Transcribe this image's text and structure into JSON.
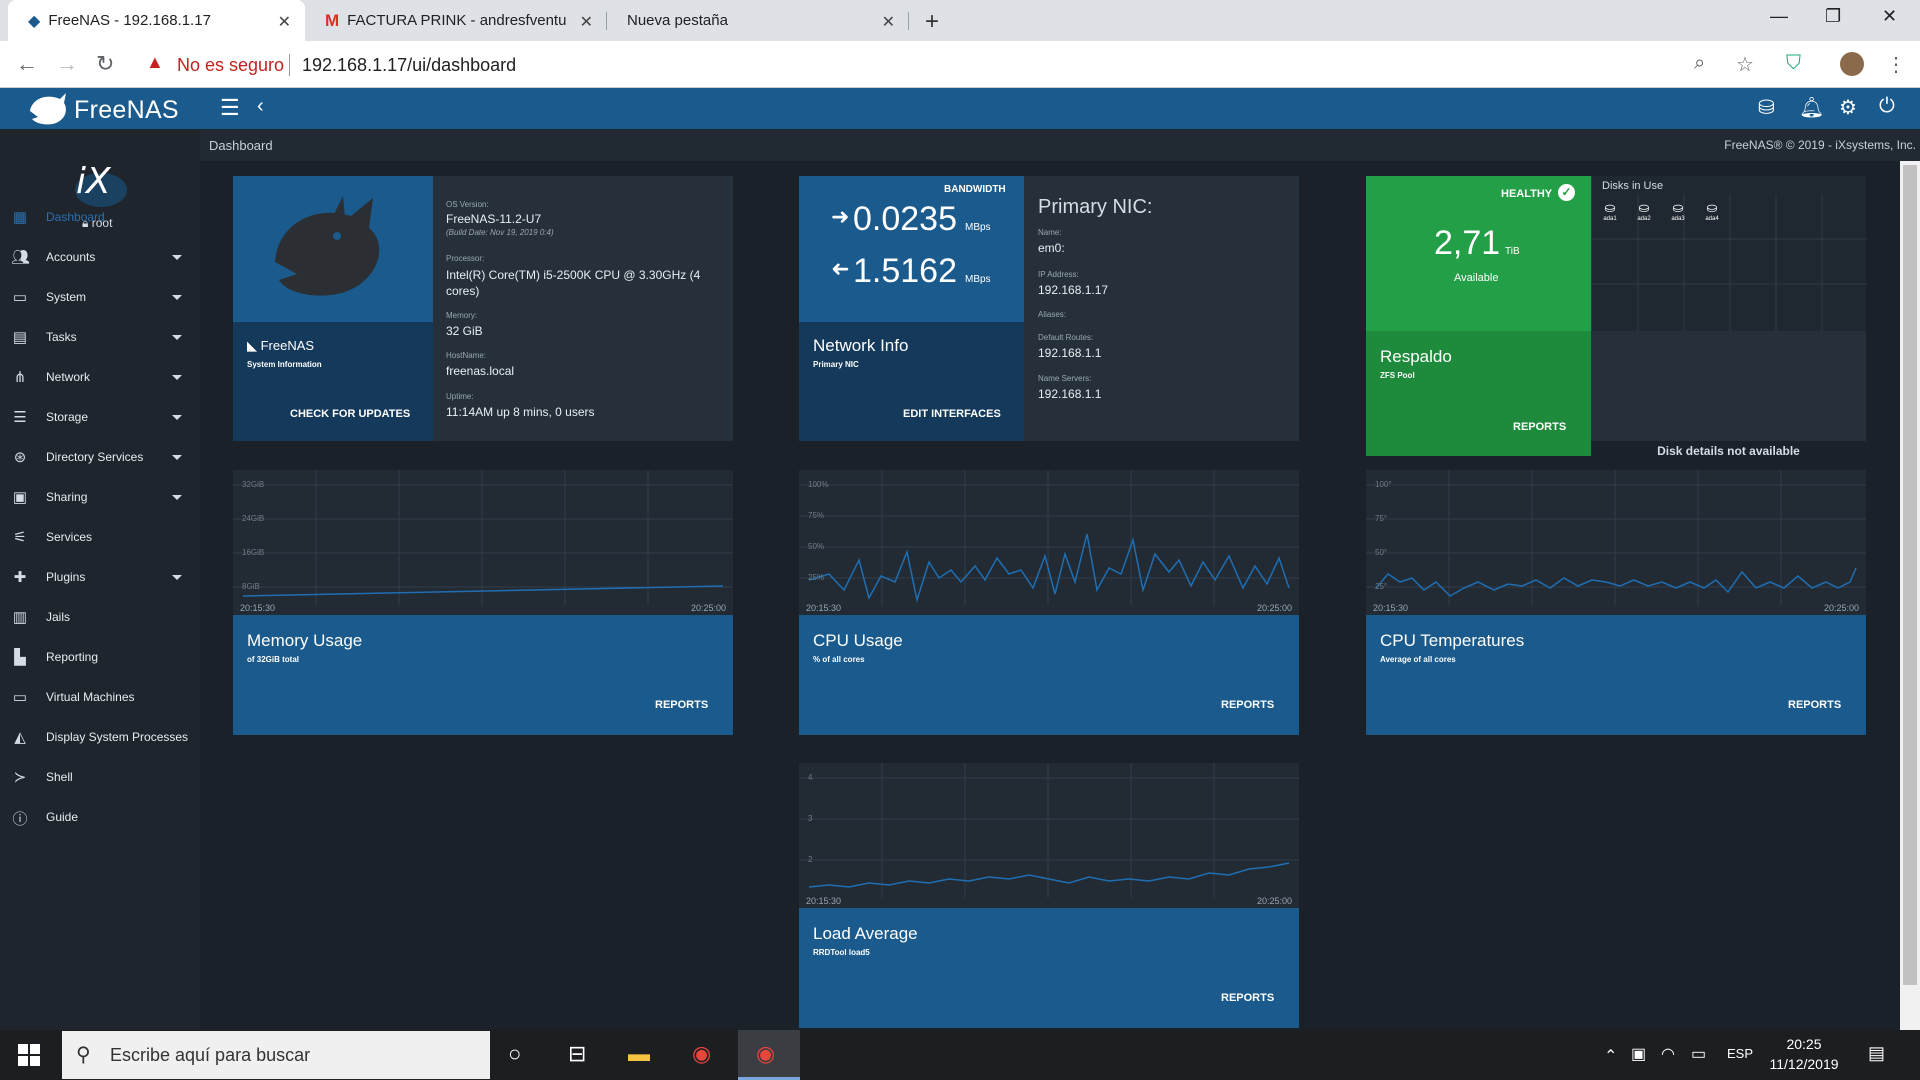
{
  "browser": {
    "tabs": [
      {
        "title": "FreeNAS - 192.168.1.17",
        "active": true
      },
      {
        "title": "FACTURA PRINK - andresfventura",
        "active": false
      },
      {
        "title": "Nueva pestaña",
        "active": false
      }
    ],
    "not_secure": "No es seguro",
    "url": "192.168.1.17/ui/dashboard"
  },
  "header": {
    "logo": "FreeNAS",
    "breadcrumb": "Dashboard",
    "copyright": "FreeNAS® © 2019 - iXsystems, Inc."
  },
  "sidebar": {
    "user": "root",
    "items": [
      {
        "label": "Dashboard",
        "icon": "dashboard-icon",
        "arrow": false
      },
      {
        "label": "Accounts",
        "icon": "accounts-icon",
        "arrow": true
      },
      {
        "label": "System",
        "icon": "system-icon",
        "arrow": true
      },
      {
        "label": "Tasks",
        "icon": "tasks-icon",
        "arrow": true
      },
      {
        "label": "Network",
        "icon": "network-icon",
        "arrow": true
      },
      {
        "label": "Storage",
        "icon": "storage-icon",
        "arrow": true
      },
      {
        "label": "Directory Services",
        "icon": "directory-icon",
        "arrow": true
      },
      {
        "label": "Sharing",
        "icon": "sharing-icon",
        "arrow": true
      },
      {
        "label": "Services",
        "icon": "services-icon",
        "arrow": false
      },
      {
        "label": "Plugins",
        "icon": "plugins-icon",
        "arrow": true
      },
      {
        "label": "Jails",
        "icon": "jails-icon",
        "arrow": false
      },
      {
        "label": "Reporting",
        "icon": "reporting-icon",
        "arrow": false
      },
      {
        "label": "Virtual Machines",
        "icon": "vm-icon",
        "arrow": false
      },
      {
        "label": "Display System Processes",
        "icon": "processes-icon",
        "arrow": false
      },
      {
        "label": "Shell",
        "icon": "shell-icon",
        "arrow": false
      },
      {
        "label": "Guide",
        "icon": "guide-icon",
        "arrow": false
      }
    ]
  },
  "sysinfo": {
    "brand": "FreeNAS",
    "subtitle": "System Information",
    "action": "CHECK FOR UPDATES",
    "os_label": "OS Version:",
    "os": "FreeNAS-11.2-U7",
    "build": "(Build Date: Nov 19, 2019 0:4)",
    "proc_label": "Processor:",
    "processor": "Intel(R) Core(TM) i5-2500K CPU @ 3.30GHz (4 cores)",
    "mem_label": "Memory:",
    "memory": "32 GiB",
    "host_label": "HostName:",
    "hostname": "freenas.local",
    "uptime_label": "Uptime:",
    "uptime": "11:14AM up 8 mins, 0 users"
  },
  "network": {
    "bandwidth_label": "BANDWIDTH",
    "out_value": "0.0235",
    "in_value": "1.5162",
    "unit": "MBps",
    "title": "Network Info",
    "subtitle": "Primary NIC",
    "action": "EDIT INTERFACES",
    "nic_title": "Primary NIC:",
    "name_label": "Name:",
    "name": "em0:",
    "ip_label": "IP Address:",
    "ip": "192.168.1.17",
    "aliases_label": "Aliases:",
    "routes_label": "Default Routes:",
    "routes": "192.168.1.1",
    "dns_label": "Name Servers:",
    "dns": "192.168.1.1"
  },
  "pool": {
    "status": "HEALTHY",
    "size": "2,71",
    "unit": "TiB",
    "available": "Available",
    "name": "Respaldo",
    "type": "ZFS Pool",
    "action": "REPORTS",
    "disks_title": "Disks in Use",
    "disks": [
      "ada1",
      "ada2",
      "ada3",
      "ada4"
    ],
    "disk_details": "Disk details not available"
  },
  "widgets": [
    {
      "title": "Memory Usage",
      "subtitle": "of 32GiB total",
      "action": "REPORTS",
      "ylabels": [
        "32GiB",
        "24GiB",
        "16GiB",
        "8GiB"
      ],
      "x_start": "20:15:30",
      "x_end": "20:25:00"
    },
    {
      "title": "CPU Usage",
      "subtitle": "% of all cores",
      "action": "REPORTS",
      "ylabels": [
        "100%",
        "75%",
        "50%",
        "25%"
      ],
      "x_start": "20:15:30",
      "x_end": "20:25:00"
    },
    {
      "title": "CPU Temperatures",
      "subtitle": "Average of all cores",
      "action": "REPORTS",
      "ylabels": [
        "100°",
        "75°",
        "50°",
        "25°"
      ],
      "x_start": "20:15:30",
      "x_end": "20:25:00"
    },
    {
      "title": "Load Average",
      "subtitle": "RRDTool load5",
      "action": "REPORTS",
      "ylabels": [
        "4",
        "3",
        "2"
      ],
      "x_start": "20:15:30",
      "x_end": "20:25:00"
    }
  ],
  "taskbar": {
    "search_placeholder": "Escribe aquí para buscar",
    "lang": "ESP",
    "time": "20:25",
    "date": "11/12/2019"
  },
  "colors": {
    "primary": "#1a5a8c",
    "healthy": "#23a047",
    "sidebar": "#1e252d"
  }
}
